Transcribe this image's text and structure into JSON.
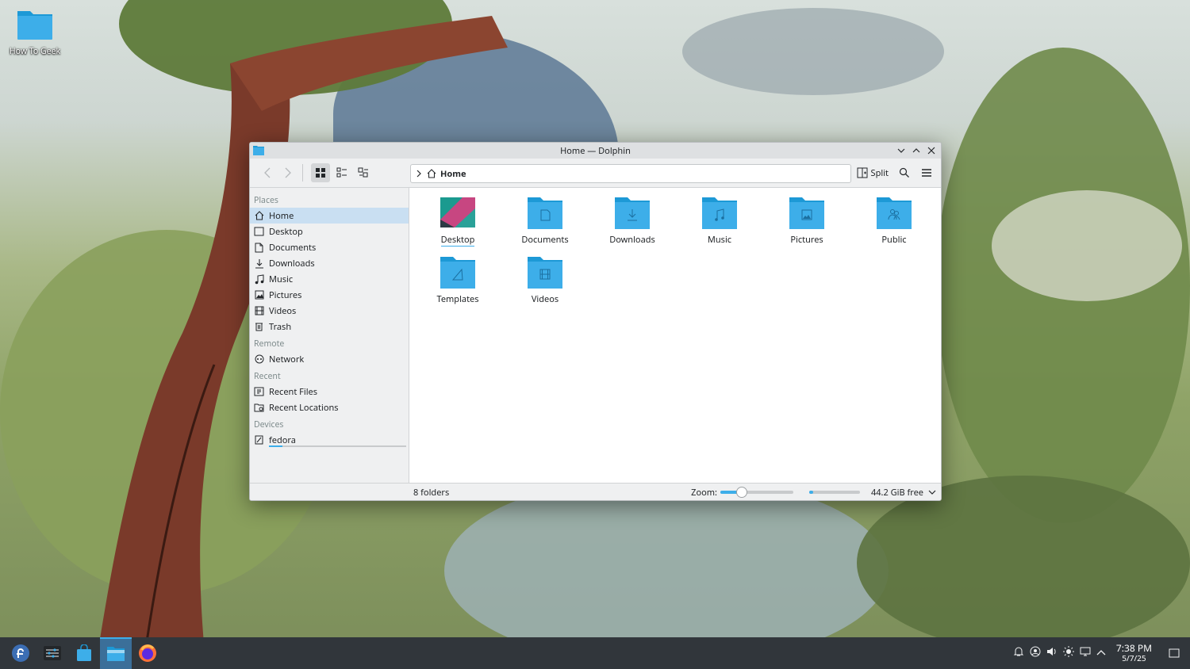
{
  "desktop": {
    "icon_label": "How To Geek"
  },
  "window": {
    "title": "Home — Dolphin",
    "breadcrumb": "Home",
    "split_label": "Split"
  },
  "sidebar": {
    "places_header": "Places",
    "places": [
      "Home",
      "Desktop",
      "Documents",
      "Downloads",
      "Music",
      "Pictures",
      "Videos",
      "Trash"
    ],
    "remote_header": "Remote",
    "remote": [
      "Network"
    ],
    "recent_header": "Recent",
    "recent": [
      "Recent Files",
      "Recent Locations"
    ],
    "devices_header": "Devices",
    "devices": [
      "fedora"
    ]
  },
  "content": {
    "folders": [
      "Desktop",
      "Documents",
      "Downloads",
      "Music",
      "Pictures",
      "Public",
      "Templates",
      "Videos"
    ]
  },
  "status": {
    "count": "8 folders",
    "zoom_label": "Zoom:",
    "free_space": "44.2 GiB free",
    "zoom_level": 0.28,
    "disk_used_fraction": 0.08
  },
  "taskbar": {
    "time": "7:38 PM",
    "date": "5/7/25"
  },
  "colors": {
    "accent": "#3daee9",
    "folder": "#3daee9",
    "folder_tab": "#1d99d6",
    "taskbar": "#31363b",
    "selection": "#c9dff2"
  }
}
